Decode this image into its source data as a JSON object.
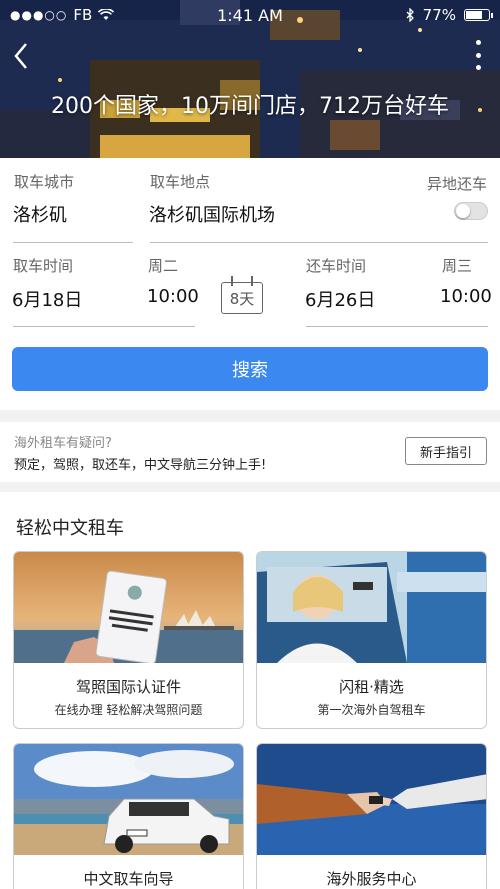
{
  "status_bar": {
    "signal_dots": "●●●○○",
    "carrier": "FB",
    "time": "1:41 AM",
    "battery": "77%",
    "battery_level": 0.77,
    "bluetooth_icon": "bluetooth-icon",
    "wifi_icon": "wifi-icon"
  },
  "header": {
    "back_icon": "chevron-left-icon",
    "more_icon": "more-vertical-icon",
    "title": "200个国家，10万间门店，712万台好车"
  },
  "form": {
    "pickup_city_label": "取车城市",
    "pickup_city": "洛杉矶",
    "pickup_location_label": "取车地点",
    "pickup_location": "洛杉矶国际机场",
    "diff_return_label": "异地还车",
    "diff_return_on": false,
    "pickup_time_label": "取车时间",
    "pickup_weekday": "周二",
    "pickup_date": "6月18日",
    "pickup_time": "10:00",
    "duration": "8天",
    "return_time_label": "还车时间",
    "return_weekday": "周三",
    "return_date": "6月26日",
    "return_time": "10:00",
    "search_label": "搜索"
  },
  "help": {
    "question": "海外租车有疑问?",
    "description": "预定，驾照，取还车，中文导航三分钟上手!",
    "guide_button": "新手指引"
  },
  "section": {
    "title": "轻松中文租车",
    "cards": [
      {
        "title": "驾照国际认证件",
        "subtitle": "在线办理 轻松解决驾照问题"
      },
      {
        "title": "闪租·精选",
        "subtitle": "第一次海外自驾租车"
      },
      {
        "title": "中文取车向导",
        "subtitle": ""
      },
      {
        "title": "海外服务中心",
        "subtitle": ""
      }
    ]
  },
  "colors": {
    "accent": "#3a88f0"
  }
}
